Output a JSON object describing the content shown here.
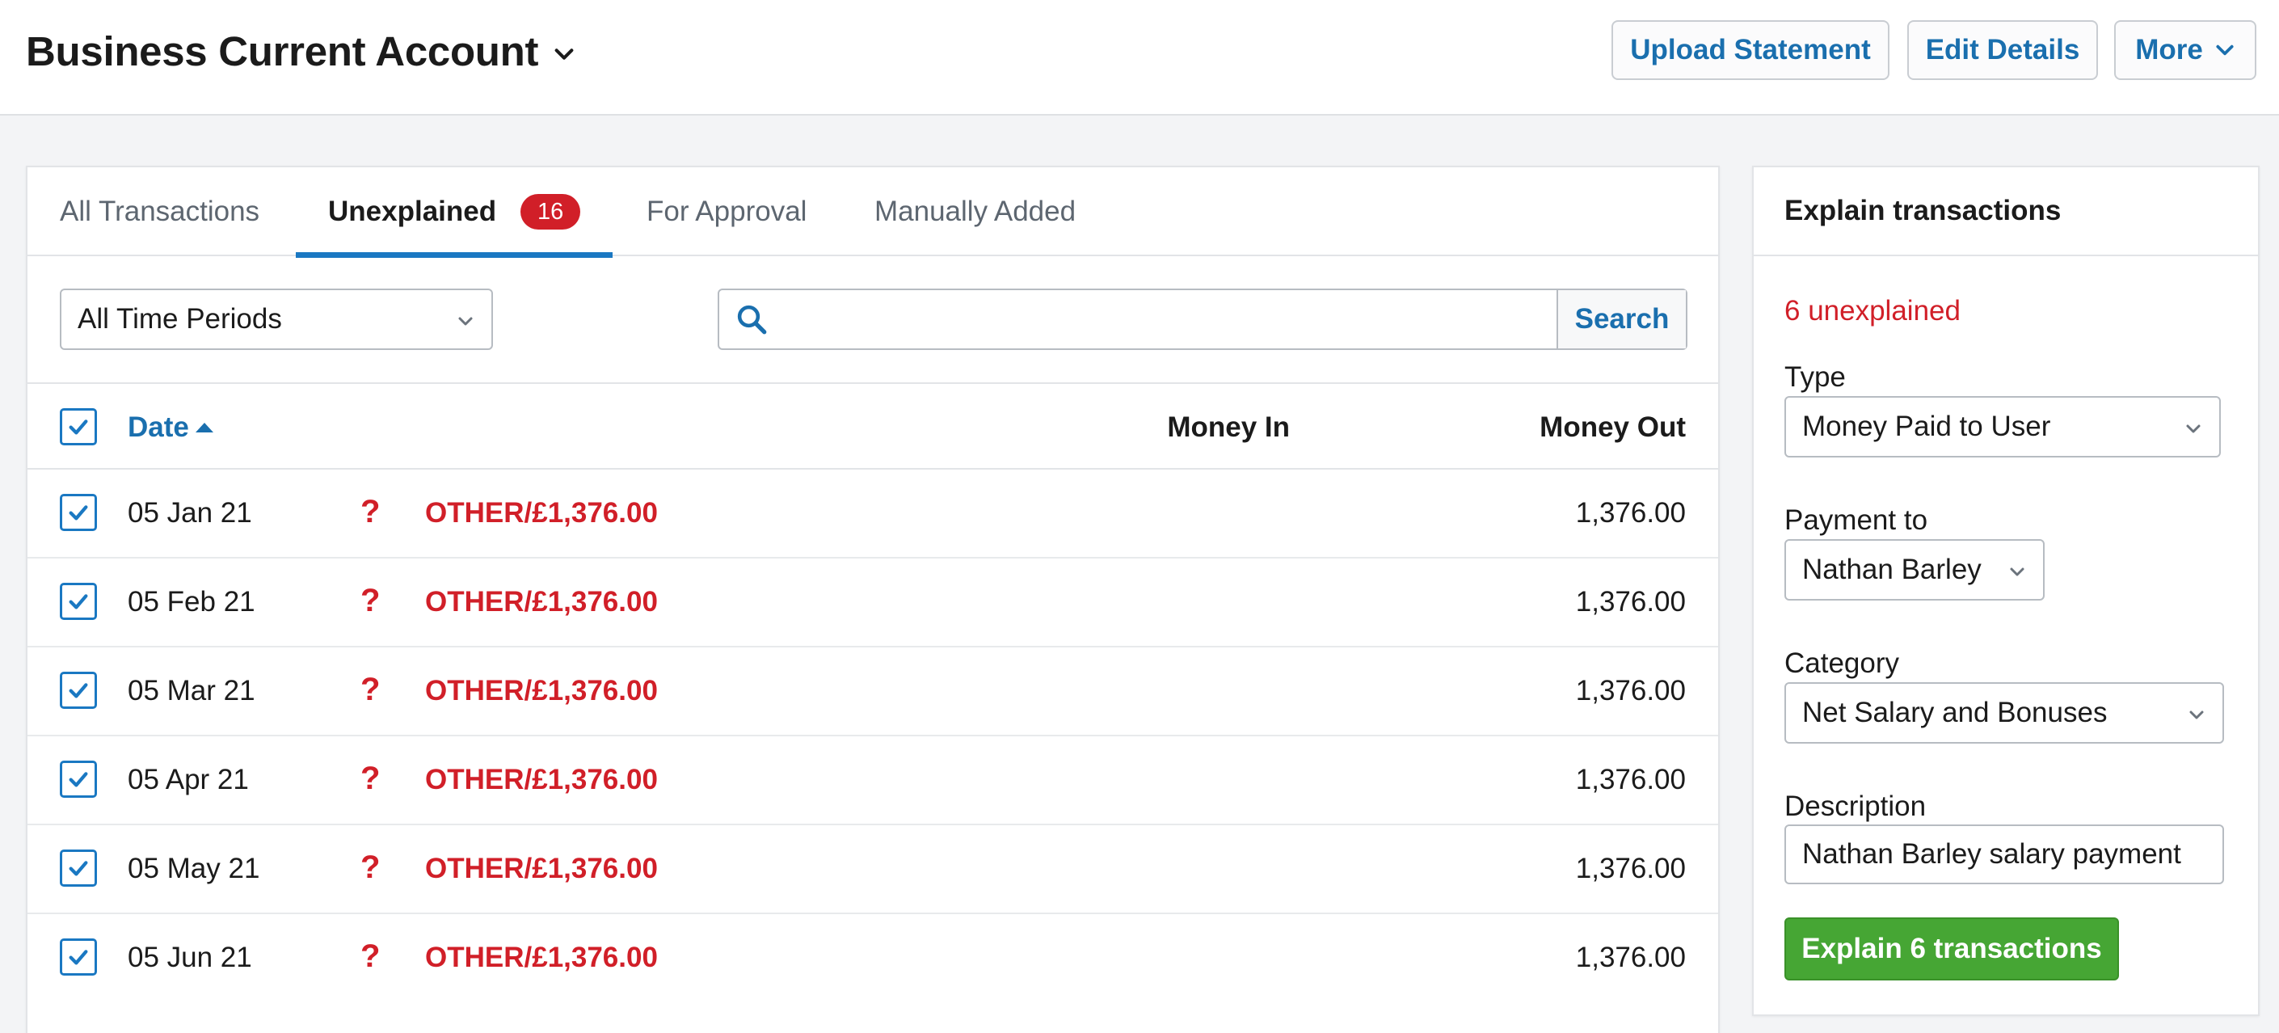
{
  "header": {
    "account_title": "Business Current Account",
    "buttons": {
      "upload": "Upload Statement",
      "edit": "Edit Details",
      "more": "More"
    }
  },
  "tabs": [
    {
      "label": "All Transactions",
      "active": false
    },
    {
      "label": "Unexplained",
      "active": true,
      "badge": "16"
    },
    {
      "label": "For Approval",
      "active": false
    },
    {
      "label": "Manually Added",
      "active": false
    }
  ],
  "filters": {
    "period": "All Time Periods",
    "search_value": "",
    "search_button": "Search"
  },
  "table": {
    "columns": {
      "date": "Date",
      "money_in": "Money In",
      "money_out": "Money Out"
    },
    "rows": [
      {
        "date": "05 Jan 21",
        "description": "OTHER/£1,376.00",
        "money_in": "",
        "money_out": "1,376.00",
        "checked": true
      },
      {
        "date": "05 Feb 21",
        "description": "OTHER/£1,376.00",
        "money_in": "",
        "money_out": "1,376.00",
        "checked": true
      },
      {
        "date": "05 Mar 21",
        "description": "OTHER/£1,376.00",
        "money_in": "",
        "money_out": "1,376.00",
        "checked": true
      },
      {
        "date": "05 Apr 21",
        "description": "OTHER/£1,376.00",
        "money_in": "",
        "money_out": "1,376.00",
        "checked": true
      },
      {
        "date": "05 May 21",
        "description": "OTHER/£1,376.00",
        "money_in": "",
        "money_out": "1,376.00",
        "checked": true
      },
      {
        "date": "05 Jun 21",
        "description": "OTHER/£1,376.00",
        "money_in": "",
        "money_out": "1,376.00",
        "checked": true
      }
    ],
    "unexplained_glyph": "?"
  },
  "side": {
    "title": "Explain transactions",
    "unexplained_count": "6 unexplained",
    "type_label": "Type",
    "type_value": "Money Paid to User",
    "payment_label": "Payment to",
    "payment_value": "Nathan Barley",
    "category_label": "Category",
    "category_value": "Net Salary and Bonuses",
    "description_label": "Description",
    "description_value": "Nathan Barley salary payment",
    "explain_button": "Explain 6 transactions"
  },
  "colors": {
    "link_blue": "#1a6fae",
    "tab_underline": "#1a78c2",
    "alert_red": "#d11f28",
    "explain_green": "#46a634"
  },
  "icons": [
    "chevron-down-icon",
    "search-icon",
    "checkmark-icon",
    "sort-ascending-icon",
    "question-mark-icon"
  ]
}
